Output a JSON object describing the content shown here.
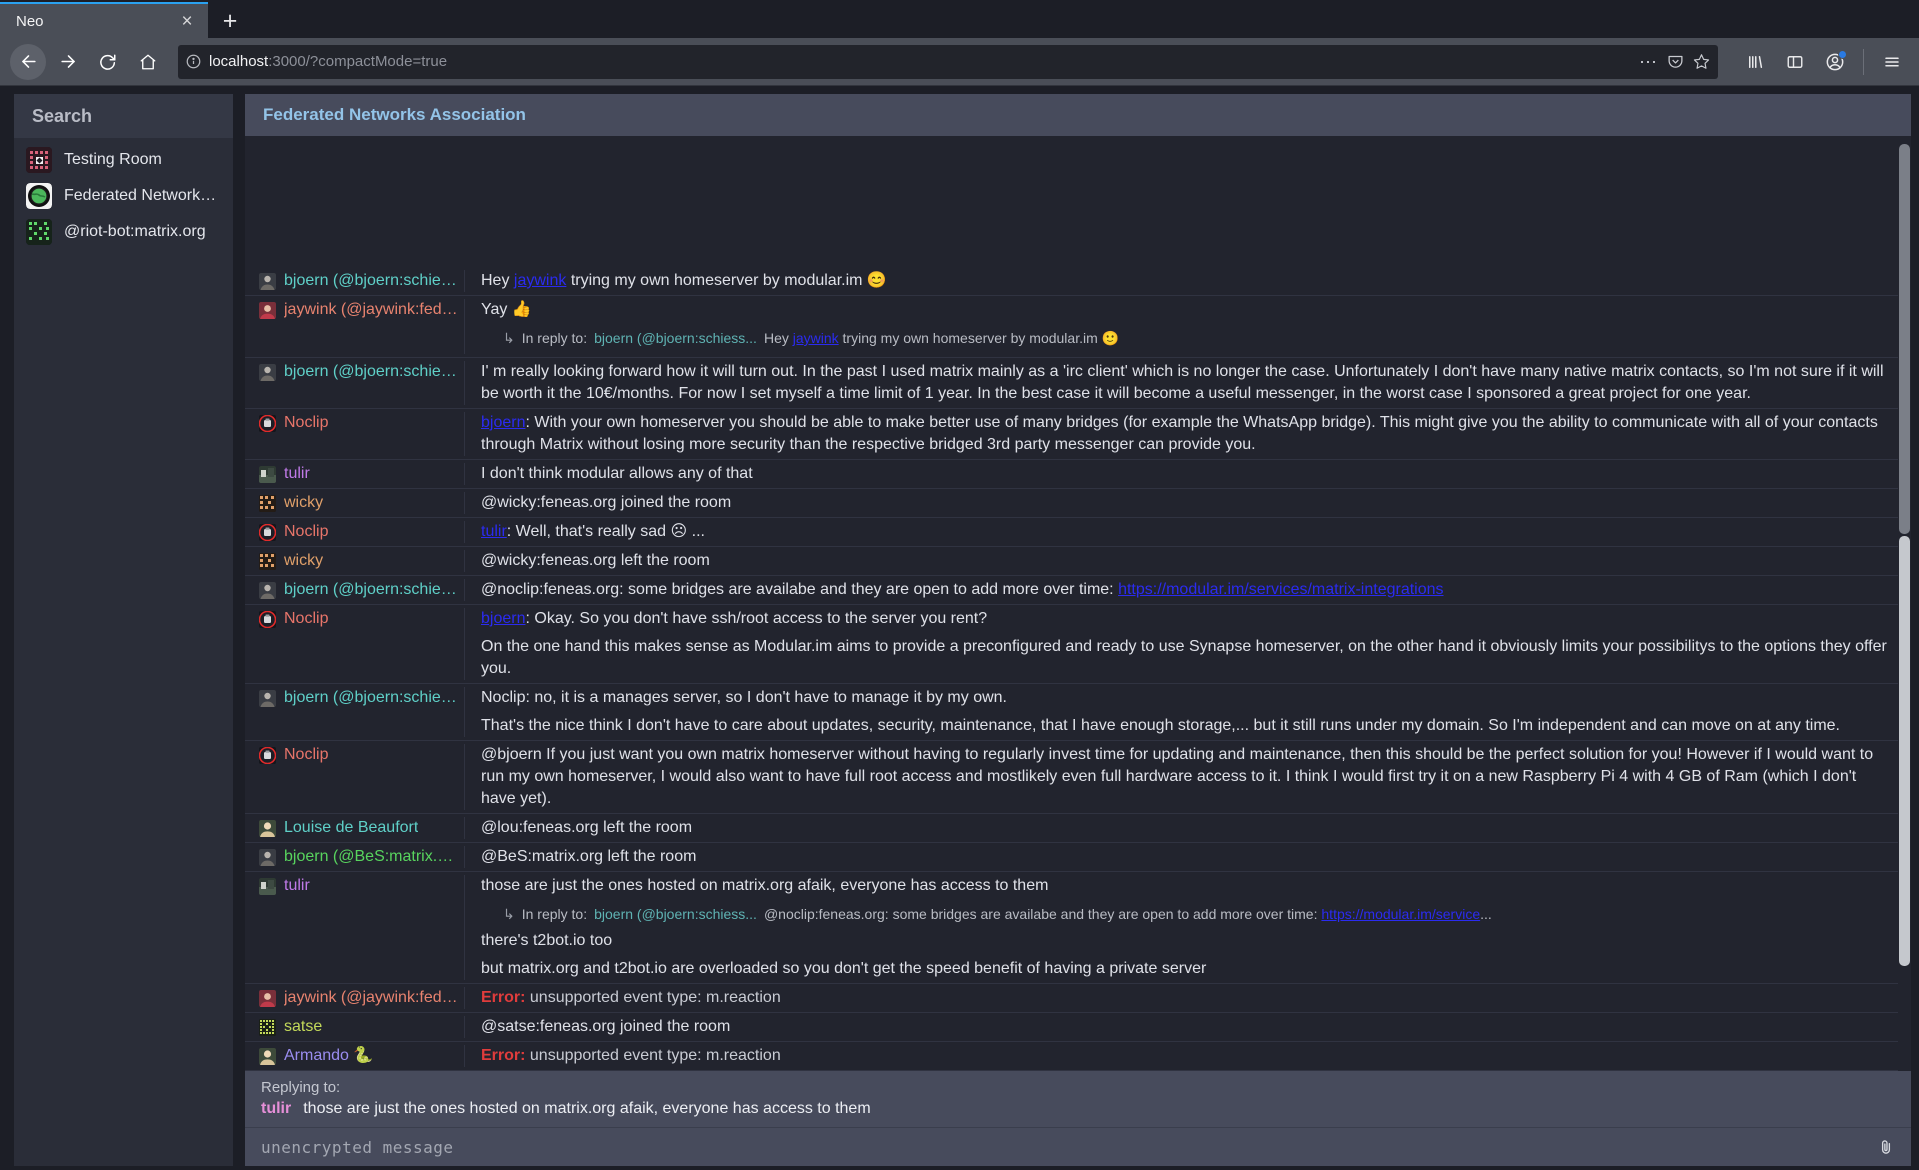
{
  "browser": {
    "tab_title": "Neo",
    "close_label": "×",
    "newtab_label": "+",
    "url_host": "localhost",
    "url_rest": ":3000/?compactMode=true",
    "url_full": "localhost:3000/?compactMode=true"
  },
  "sidebar": {
    "search_label": "Search",
    "rooms": [
      {
        "name": "Testing Room",
        "avatar": "pink-pixel-avatar"
      },
      {
        "name": "Federated Networks Ass...",
        "avatar": "green-globe-avatar"
      },
      {
        "name": "@riot-bot:matrix.org",
        "avatar": "green-pixel-avatar"
      }
    ]
  },
  "room": {
    "title": "Federated Networks Association"
  },
  "events": [
    {
      "sender": "bjoern (@bjoern:schiess...",
      "sender_color": "#5fd0c8",
      "avatar": "photo-dark",
      "clipped_top": true,
      "lines": [
        {
          "parts": [
            {
              "t": "Hey "
            },
            {
              "t": "jaywink",
              "link": true
            },
            {
              "t": " trying my own homeserver by modular.im 😊"
            }
          ]
        }
      ]
    },
    {
      "sender": "jaywink (@jaywink:feder...",
      "sender_color": "#e8836f",
      "avatar": "photo-red",
      "lines": [
        {
          "parts": [
            {
              "t": "Yay 👍"
            }
          ]
        }
      ],
      "reply_context": {
        "label": "In reply to:",
        "who": "bjoern (@bjoern:schiess...",
        "parts": [
          {
            "t": "Hey "
          },
          {
            "t": "jaywink",
            "link": true
          },
          {
            "t": " trying my own homeserver by modular.im 🙂"
          }
        ]
      }
    },
    {
      "sender": "bjoern (@bjoern:schiess...",
      "sender_color": "#5fd0c8",
      "avatar": "photo-dark",
      "lines": [
        {
          "parts": [
            {
              "t": "I' m really looking forward how it will turn out. In the past I used matrix mainly as a 'irc client' which is no longer the case. Unfortunately I don't have many native matrix contacts, so I'm not sure if it will be worth it the 10€/months. For now I set myself a time limit of 1 year. In the best case it will become a useful messenger, in the worst case I sponsored a great project for one year."
            }
          ]
        }
      ]
    },
    {
      "sender": "Noclip",
      "sender_color": "#e8756a",
      "avatar": "red-circle",
      "lines": [
        {
          "parts": [
            {
              "t": "bjoern",
              "link": true
            },
            {
              "t": ": With your own homeserver you should be able to make better use of many bridges (for example the WhatsApp bridge). This might give you the ability to communicate with all of your contacts through Matrix without losing more security than the respective bridged 3rd party messenger can provide you."
            }
          ]
        }
      ]
    },
    {
      "sender": "tulir",
      "sender_color": "#c07ae8",
      "avatar": "photo-grey",
      "compact": true,
      "lines": [
        {
          "parts": [
            {
              "t": "I don't think modular allows any of that"
            }
          ]
        }
      ]
    },
    {
      "sender": "wicky",
      "sender_color": "#e0a06a",
      "avatar": "orange-pixel",
      "compact": true,
      "lines": [
        {
          "parts": [
            {
              "t": "@wicky:feneas.org joined the room"
            }
          ]
        }
      ]
    },
    {
      "sender": "Noclip",
      "sender_color": "#e8756a",
      "avatar": "red-circle",
      "compact": true,
      "lines": [
        {
          "parts": [
            {
              "t": "tulir",
              "link": true
            },
            {
              "t": ": Well, that's really sad ☹ ..."
            }
          ]
        }
      ]
    },
    {
      "sender": "wicky",
      "sender_color": "#e0a06a",
      "avatar": "orange-pixel",
      "compact": true,
      "lines": [
        {
          "parts": [
            {
              "t": "@wicky:feneas.org left the room"
            }
          ]
        }
      ]
    },
    {
      "sender": "bjoern (@bjoern:schiess...",
      "sender_color": "#5fd0c8",
      "avatar": "photo-dark",
      "compact": true,
      "lines": [
        {
          "parts": [
            {
              "t": "@noclip:feneas.org: some bridges are availabe and they are open to add more over time: "
            },
            {
              "t": "https://modular.im/services/matrix-integrations",
              "link": true
            }
          ]
        }
      ]
    },
    {
      "sender": "Noclip",
      "sender_color": "#e8756a",
      "avatar": "red-circle",
      "lines": [
        {
          "parts": [
            {
              "t": "bjoern",
              "link": true
            },
            {
              "t": ": Okay. So you don't have ssh/root access to the server you rent?"
            }
          ]
        },
        {
          "parts": [
            {
              "t": "On the one hand this makes sense as Modular.im aims to provide a preconfigured and ready to use Synapse homeserver, on the other hand it obviously limits your possibilitys to the options they offer you."
            }
          ]
        }
      ]
    },
    {
      "sender": "bjoern (@bjoern:schiess...",
      "sender_color": "#5fd0c8",
      "avatar": "photo-dark",
      "lines": [
        {
          "parts": [
            {
              "t": "Noclip: no, it is a manages server, so I don't have to manage it by my own."
            }
          ]
        },
        {
          "parts": [
            {
              "t": "That's the nice think I don't have to care about updates, security, maintenance, that I have enough storage,... but it still runs under my domain. So I'm independent and can move on at any time."
            }
          ]
        }
      ]
    },
    {
      "sender": "Noclip",
      "sender_color": "#e8756a",
      "avatar": "red-circle",
      "lines": [
        {
          "parts": [
            {
              "t": "@bjoern If you just want you own matrix homeserver without having to regularly invest time for updating and maintenance, then this should be the perfect solution for you! However if I would want to run my own homeserver, I would also want to have full root access and mostlikely even full hardware access to it. I think I would first try it on a new Raspberry Pi 4 with 4 GB of Ram (which I don't have yet)."
            }
          ]
        }
      ]
    },
    {
      "sender": "Louise de Beaufort",
      "sender_color": "#5fd0c8",
      "avatar": "photo-blonde",
      "compact": true,
      "lines": [
        {
          "parts": [
            {
              "t": "@lou:feneas.org left the room"
            }
          ]
        }
      ]
    },
    {
      "sender": "bjoern (@BeS:matrix.org)",
      "sender_color": "#58d45e",
      "avatar": "photo-dark",
      "compact": true,
      "lines": [
        {
          "parts": [
            {
              "t": "@BeS:matrix.org left the room"
            }
          ]
        }
      ]
    },
    {
      "sender": "tulir",
      "sender_color": "#c07ae8",
      "avatar": "photo-grey",
      "lines": [
        {
          "parts": [
            {
              "t": "those are just the ones hosted on matrix.org afaik, everyone has access to them"
            }
          ]
        }
      ],
      "reply_context_after_first": {
        "label": "In reply to:",
        "who": "bjoern (@bjoern:schiess...",
        "parts": [
          {
            "t": "@noclip:feneas.org: some bridges are availabe and they are open to add more over time: "
          },
          {
            "t": "https://modular.im/service",
            "link": true
          },
          {
            "t": "..."
          }
        ]
      },
      "more_lines": [
        {
          "parts": [
            {
              "t": "there's t2bot.io too"
            }
          ]
        },
        {
          "parts": [
            {
              "t": "but matrix.org and t2bot.io are overloaded so you don't get the speed benefit of having a private server"
            }
          ]
        }
      ]
    },
    {
      "sender": "jaywink (@jaywink:feder...",
      "sender_color": "#e8836f",
      "avatar": "photo-red",
      "compact": true,
      "error_label": "Error:",
      "error_text": "unsupported event type: m.reaction"
    },
    {
      "sender": "satse",
      "sender_color": "#c3d95a",
      "avatar": "green-grid",
      "compact": true,
      "lines": [
        {
          "parts": [
            {
              "t": "@satse:feneas.org joined the room"
            }
          ]
        }
      ]
    },
    {
      "sender": "Armando 🐍",
      "sender_color": "#9a8df0",
      "avatar": "photo-blonde",
      "compact": true,
      "error_label": "Error:",
      "error_text": "unsupported event type: m.reaction"
    }
  ],
  "composer": {
    "replying_label": "Replying to:",
    "reply_who": "tulir",
    "reply_text": "those are just the ones hosted on matrix.org afaik, everyone has access to them",
    "placeholder": "unencrypted message",
    "attach_icon": "paperclip-icon"
  },
  "colors": {
    "accent": "#93c4e8",
    "link": "#2b2bf0",
    "error": "#e03c3c",
    "header_bg": "#474b5c",
    "panel_bg": "#22242e",
    "sidebar_bg": "#2a2d38"
  }
}
